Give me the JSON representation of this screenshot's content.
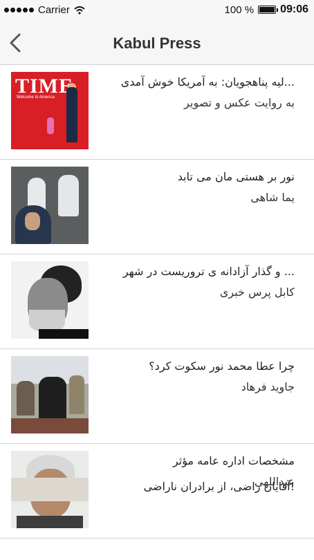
{
  "statusbar": {
    "carrier": "Carrier",
    "battery": "100 %",
    "time": "09:06"
  },
  "navbar": {
    "title": "Kabul Press",
    "back_icon": "chevron-left-icon"
  },
  "articles": [
    {
      "title": "...لیه پناهجویان: به آمریکا خوش آمدی",
      "subtitle": "به روایت عکس و تصویر",
      "thumb": "time-magazine-cover"
    },
    {
      "title": "نور بر هستی مان می تابد",
      "subtitle": "یما شاهی",
      "thumb": "man-by-rock-arches"
    },
    {
      "title": "... و گذار آزادانه ی تروریست در شهر",
      "subtitle": "کابل پرس خبری",
      "thumb": "bearded-man-portrait"
    },
    {
      "title": "چرا عطا محمد نور سکوت کرد؟",
      "subtitle": "جاوید فرهاد",
      "thumb": "group-seated"
    },
    {
      "title": "مشخصات اداره عامه مؤثر",
      "subtitle": "عبداللهی",
      "thumb": "man-with-glasses"
    },
    {
      "title": "!آقایان راضی، از برادران ناراضی",
      "subtitle": "",
      "thumb": "partial"
    }
  ]
}
